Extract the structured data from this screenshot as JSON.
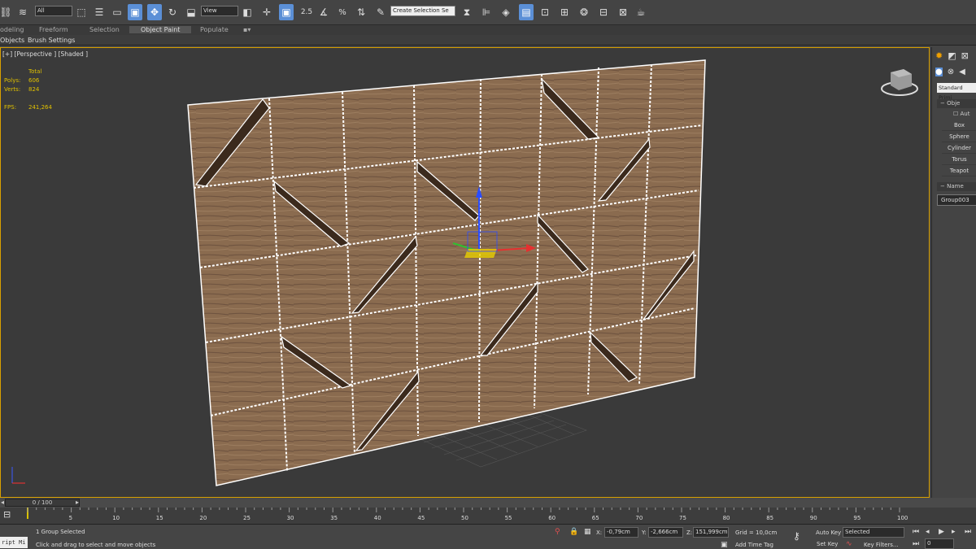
{
  "toolbar": {
    "filter_value": "All",
    "refcoord_value": "View",
    "snap_label": "2.5",
    "named_selection_value": "Create Selection Se"
  },
  "ribbon": {
    "tabs": [
      {
        "label": "odeling"
      },
      {
        "label": "Freeform"
      },
      {
        "label": "Selection"
      },
      {
        "label": "Object Paint"
      },
      {
        "label": "Populate"
      }
    ]
  },
  "subtabs": {
    "objects": "Objects",
    "brush_settings": "Brush Settings"
  },
  "viewport": {
    "label": "[+] [Perspective ] [Shaded ]",
    "stats": {
      "total_label": "Total",
      "polys_label": "Polys:",
      "polys_value": "606",
      "verts_label": "Verts:",
      "verts_value": "824",
      "fps_label": "FPS:",
      "fps_value": "241,264"
    }
  },
  "panel": {
    "dropdown_value": "Standard Primi",
    "rollout_title": "Obje",
    "autogrid": "Aut",
    "buttons": [
      "Box",
      "Sphere",
      "Cylinder",
      "Torus",
      "Teapot"
    ],
    "name_label": "Name",
    "name_value": "Group003"
  },
  "timeline": {
    "slider_label": "0 / 100",
    "ticks": [
      "0",
      "5",
      "10",
      "15",
      "20",
      "25",
      "30",
      "35",
      "40",
      "45",
      "50",
      "55",
      "60",
      "65",
      "70",
      "75",
      "80",
      "85",
      "90",
      "95",
      "100"
    ]
  },
  "status": {
    "script_label": "ript Mi",
    "selection": "1 Group Selected",
    "prompt": "Click and drag to select and move objects",
    "x_label": "X:",
    "x_value": "-0,79cm",
    "y_label": "Y:",
    "y_value": "-2,666cm",
    "z_label": "Z:",
    "z_value": "151,999cm",
    "grid": "Grid = 10,0cm",
    "add_time_tag": "Add Time Tag",
    "auto_key": "Auto Key",
    "auto_key_value": "Selected",
    "set_key": "Set Key",
    "key_filters": "Key Filters...",
    "frame_value": "0"
  },
  "colors": {
    "accent": "#5b8fd6",
    "viewport_border": "#d8a000",
    "wood": "#8a6b4f",
    "wood_dark": "#3b2a1d",
    "stats": "#e0c000"
  }
}
